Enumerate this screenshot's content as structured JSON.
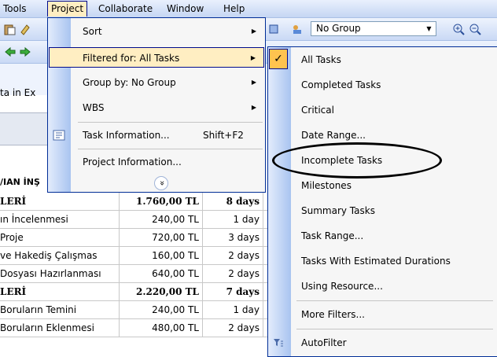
{
  "menubar": {
    "items": [
      {
        "label": "Tools"
      },
      {
        "label": "Project"
      },
      {
        "label": "Collaborate"
      },
      {
        "label": "Window"
      },
      {
        "label": "Help"
      }
    ]
  },
  "toolbar": {
    "group_select_value": "No Group"
  },
  "left_fragments": {
    "data_in": "ta in Ex",
    "header": "/IAN İNŞ"
  },
  "project_menu": {
    "items": [
      {
        "label": "Sort",
        "shortcut": "",
        "submenu": true
      },
      {
        "label": "Filtered for: All Tasks",
        "shortcut": "",
        "submenu": true
      },
      {
        "label": "Group by: No Group",
        "shortcut": "",
        "submenu": true
      },
      {
        "label": "WBS",
        "shortcut": "",
        "submenu": true
      },
      {
        "label": "Task Information...",
        "shortcut": "Shift+F2",
        "submenu": false
      },
      {
        "label": "Project Information...",
        "shortcut": "",
        "submenu": false
      }
    ],
    "expand_glyph": "»"
  },
  "filter_menu": {
    "items": [
      {
        "label": "All Tasks",
        "checked": true
      },
      {
        "label": "Completed Tasks"
      },
      {
        "label": "Critical"
      },
      {
        "label": "Date Range..."
      },
      {
        "label": "Incomplete Tasks"
      },
      {
        "label": "Milestones"
      },
      {
        "label": "Summary Tasks"
      },
      {
        "label": "Task Range..."
      },
      {
        "label": "Tasks With Estimated Durations"
      },
      {
        "label": "Using Resource..."
      },
      {
        "label": "More Filters..."
      },
      {
        "label": "AutoFilter"
      }
    ]
  },
  "grid": {
    "rows": [
      {
        "name": "LERİ",
        "cost": "1.760,00 TL",
        "duration": "8 days",
        "bold": true
      },
      {
        "name": "ın İncelenmesi",
        "cost": "240,00 TL",
        "duration": "1 day",
        "bold": false
      },
      {
        "name": " Proje",
        "cost": "720,00 TL",
        "duration": "3 days",
        "bold": false
      },
      {
        "name": " ve Hakediş Çalışmas",
        "cost": "160,00 TL",
        "duration": "2 days",
        "bold": false
      },
      {
        "name": "Dosyası Hazırlanması",
        "cost": "640,00 TL",
        "duration": "2 days",
        "bold": false
      },
      {
        "name": "LERİ",
        "cost": "2.220,00 TL",
        "duration": "7 days",
        "bold": true
      },
      {
        "name": "Boruların Temini",
        "cost": "240,00 TL",
        "duration": "1 day",
        "bold": false
      },
      {
        "name": "Boruların Eklenmesi",
        "cost": "480,00 TL",
        "duration": "2 days",
        "bold": false
      }
    ]
  }
}
